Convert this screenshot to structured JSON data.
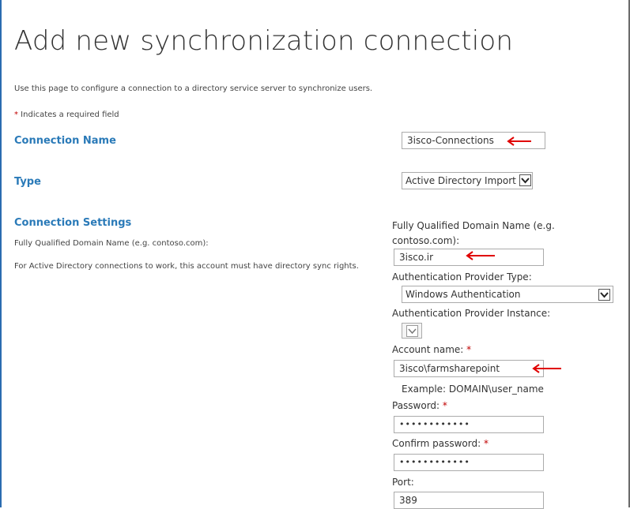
{
  "page": {
    "title": "Add new synchronization connection",
    "intro": "Use this page to configure a connection to a directory service server to synchronize users.",
    "required_note_star": "*",
    "required_note": " Indicates a required field"
  },
  "sections": {
    "connection_name": {
      "label": "Connection Name",
      "value": "3isco-Connections"
    },
    "type": {
      "label": "Type",
      "selected": "Active Directory Import"
    },
    "connection_settings": {
      "label": "Connection Settings",
      "desc1": "Fully Qualified Domain Name (e.g. contoso.com):",
      "desc2": "For Active Directory connections to work, this account must have directory sync rights."
    }
  },
  "fields": {
    "fqdn_label_line1": "Fully Qualified Domain Name (e.g.",
    "fqdn_label_line2": "contoso.com):",
    "fqdn_value": "3isco.ir",
    "auth_provider_type_label": "Authentication Provider Type:",
    "auth_provider_type_value": "Windows Authentication",
    "auth_provider_instance_label": "Authentication Provider Instance:",
    "account_name_label": "Account name:",
    "account_name_value": "3isco\\farmsharepoint",
    "account_example": "Example: DOMAIN\\user_name",
    "password_label": "Password:",
    "password_value": "••••••••••••",
    "confirm_password_label": "Confirm password:",
    "confirm_password_value": "••••••••••••",
    "port_label": "Port:",
    "port_value": "389",
    "required_star": "*"
  },
  "colors": {
    "accent": "#2a7ab8",
    "required": "#c00000",
    "annotation_arrow": "#e00000"
  },
  "icons": [
    "chevron-down-icon",
    "red-arrow-annotation"
  ]
}
